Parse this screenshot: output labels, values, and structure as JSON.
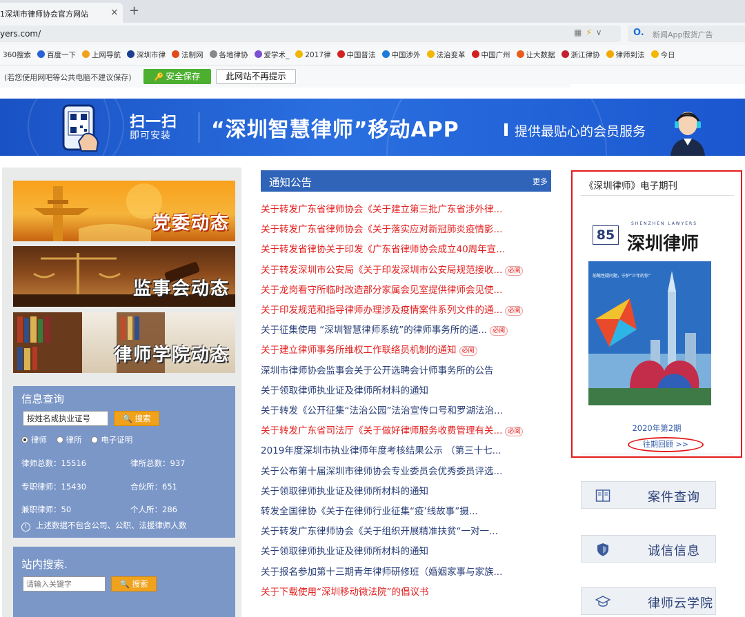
{
  "browser": {
    "tab_title": "1深圳市律师协会官方网站",
    "url": "yers.com/",
    "search_placeholder": "新闻App假货广告",
    "bookmarks": [
      {
        "label": "360搜索",
        "color": "#2fa84f"
      },
      {
        "label": "百度一下",
        "color": "#2a62d6"
      },
      {
        "label": "上网导航",
        "color": "#f0a21c"
      },
      {
        "label": "深圳市律",
        "color": "#1c3f8f"
      },
      {
        "label": "法制网",
        "color": "#e04b1a"
      },
      {
        "label": "各地律协",
        "color": "#888888"
      },
      {
        "label": "爱学术_",
        "color": "#7a4fd1"
      },
      {
        "label": "2017律",
        "color": "#f2b705"
      },
      {
        "label": "中国普法",
        "color": "#d42020"
      },
      {
        "label": "中国涉外",
        "color": "#1c7ad8"
      },
      {
        "label": "法治变革",
        "color": "#f2b705"
      },
      {
        "label": "中国广州",
        "color": "#d42020"
      },
      {
        "label": "让大数据",
        "color": "#e85d1a"
      },
      {
        "label": "浙江律协",
        "color": "#c21f2f"
      },
      {
        "label": "律师到法",
        "color": "#f2a900"
      },
      {
        "label": "今日",
        "color": "#f2b705"
      }
    ],
    "save_tip": "(若您使用网吧等公共电脑不建议保存)",
    "save_button": "安全保存",
    "nosave_button": "此网站不再提示"
  },
  "banner": {
    "scan_line1": "扫一扫",
    "scan_line2": "即可安装",
    "title": "“深圳智慧律师”移动APP",
    "subtitle": "提供最贴心的会员服务"
  },
  "left": {
    "pic_links": [
      "党委动态",
      "监事会动态",
      "律师学院动态"
    ],
    "info": {
      "title": "信息查询",
      "input_value": "按姓名或执业证号",
      "search_button": "搜索",
      "radios": [
        "律师",
        "律所",
        "电子证明"
      ],
      "stats": [
        {
          "label": "律师总数：",
          "value": "15516"
        },
        {
          "label": "律所总数：",
          "value": "937"
        },
        {
          "label": "专职律师：",
          "value": "15430"
        },
        {
          "label": "合伙所：",
          "value": "651"
        },
        {
          "label": "兼职律师：",
          "value": "50"
        },
        {
          "label": "个人所：",
          "value": "286"
        }
      ],
      "note_icon": "info-circle-icon",
      "note": "上述数据不包含公司、公职、法援律师人数"
    },
    "site_search": {
      "title": "站内搜索.",
      "placeholder": "请输入关键字",
      "search_button": "搜索"
    }
  },
  "notices": {
    "title": "通知公告",
    "more": "更多",
    "must_read_label": "必阅",
    "items": [
      {
        "text": "关于转发广东省律师协会《关于建立第三批广东省涉外律...",
        "red": true,
        "must": false
      },
      {
        "text": "关于转发广东省律师协会《关于落实应对新冠肺炎疫情影...",
        "red": true,
        "must": false
      },
      {
        "text": "关于转发省律协关于印发《广东省律师协会成立40周年宣...",
        "red": true,
        "must": false
      },
      {
        "text": "关于转发深圳市公安局《关于印发深圳市公安局规范接收...",
        "red": true,
        "must": true
      },
      {
        "text": "关于龙岗看守所临时改造部分家属会见室提供律师会见使...",
        "red": true,
        "must": false
      },
      {
        "text": "关于印发规范和指导律师办理涉及疫情案件系列文件的通...",
        "red": true,
        "must": true
      },
      {
        "text": "关于征集使用 “深圳智慧律师系统”的律师事务所的通...",
        "red": false,
        "must": true
      },
      {
        "text": "关于建立律师事务所维权工作联络员机制的通知",
        "red": true,
        "must": true
      },
      {
        "text": "深圳市律师协会监事会关于公开选聘会计师事务所的公告",
        "red": false,
        "must": false
      },
      {
        "text": "关于领取律师执业证及律师所材料的通知",
        "red": false,
        "must": false
      },
      {
        "text": "关于转发《公开征集“法治公园”法治宣传口号和罗湖法治...",
        "red": false,
        "must": false
      },
      {
        "text": "关于转发广东省司法厅《关于做好律师服务收费管理有关...",
        "red": true,
        "must": true
      },
      {
        "text": "2019年度深圳市执业律师年度考核结果公示 （第三十七...",
        "red": false,
        "must": false
      },
      {
        "text": "关于公布第十届深圳市律师协会专业委员会优秀委员评选...",
        "red": false,
        "must": false
      },
      {
        "text": "关于领取律师执业证及律师所材料的通知",
        "red": false,
        "must": false
      },
      {
        "text": "转发全国律协《关于在律师行业征集“疫’线故事”摄...",
        "red": false,
        "must": false
      },
      {
        "text": "关于转发广东律师协会《关于组织开展精准扶贫“一对一...",
        "red": false,
        "must": false
      },
      {
        "text": "关于领取律师执业证及律师所材料的通知",
        "red": false,
        "must": false
      },
      {
        "text": "关于报名参加第十三期青年律师研修班（婚姻家事与家族...",
        "red": false,
        "must": false
      },
      {
        "text": "关于下载使用“深圳移动微法院”的倡议书",
        "red": true,
        "must": false
      }
    ]
  },
  "journal": {
    "title": "《深圳律师》电子期刊",
    "cover_number": "85",
    "cover_en": "SHENZHEN LAWYERS",
    "cover_cn": "深圳律师",
    "cover_headline": "前瞻性疑问题，守护“少年的你”",
    "issue": "2020年第2期",
    "past": "往期回顾 >>"
  },
  "quick_links": [
    {
      "label": "案件查询",
      "icon": "book-icon"
    },
    {
      "label": "诚信信息",
      "icon": "shield-icon"
    },
    {
      "label": "律师云学院",
      "icon": "graduation-cap-icon"
    }
  ]
}
